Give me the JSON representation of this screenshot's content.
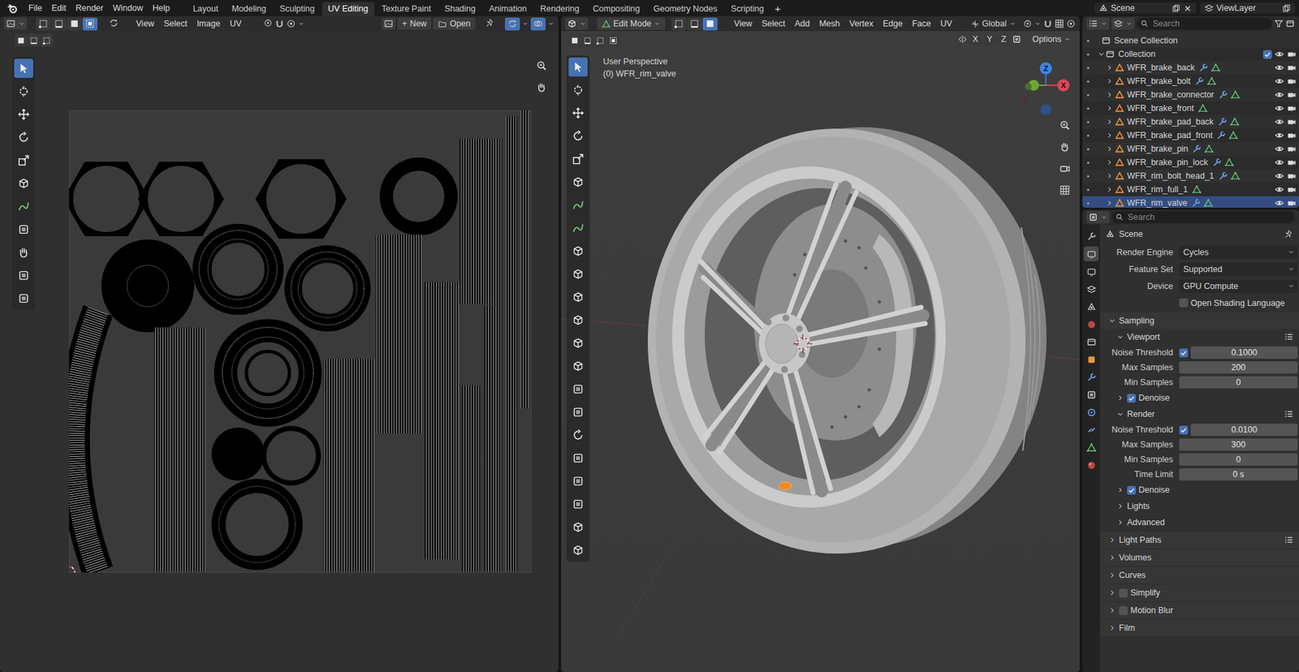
{
  "menubar": {
    "menus": [
      "File",
      "Edit",
      "Render",
      "Window",
      "Help"
    ],
    "workspaces": [
      {
        "label": "Layout",
        "selected": false
      },
      {
        "label": "Modeling",
        "selected": false
      },
      {
        "label": "Sculpting",
        "selected": false
      },
      {
        "label": "UV Editing",
        "selected": true
      },
      {
        "label": "Texture Paint",
        "selected": false
      },
      {
        "label": "Shading",
        "selected": false
      },
      {
        "label": "Animation",
        "selected": false
      },
      {
        "label": "Rendering",
        "selected": false
      },
      {
        "label": "Compositing",
        "selected": false
      },
      {
        "label": "Geometry Nodes",
        "selected": false
      },
      {
        "label": "Scripting",
        "selected": false
      }
    ],
    "add_workspace": "+",
    "scene": "Scene",
    "view_layer": "ViewLayer"
  },
  "uv_editor": {
    "select_modes": [
      {
        "selected": false
      },
      {
        "selected": false
      },
      {
        "selected": false
      },
      {
        "selected": true
      }
    ],
    "menus": [
      "View",
      "Select",
      "Image",
      "UV"
    ],
    "new_button": {
      "icon": "+",
      "label": "New"
    },
    "open_button": "Open",
    "tools": [
      {
        "selected": true
      },
      {
        "selected": false
      },
      {
        "selected": false
      },
      {
        "selected": false
      },
      {
        "selected": false
      },
      {
        "selected": false
      },
      {
        "selected": false
      },
      {
        "selected": false
      },
      {
        "selected": false
      },
      {
        "selected": false
      },
      {
        "selected": false
      }
    ]
  },
  "viewport": {
    "mode": "Edit Mode",
    "select_modes": [
      {
        "selected": false
      },
      {
        "selected": false
      },
      {
        "selected": true
      }
    ],
    "menus": [
      "View",
      "Select",
      "Add",
      "Mesh",
      "Vertex",
      "Edge",
      "Face",
      "UV"
    ],
    "orientation": "Global",
    "mirror_axes": [
      "X",
      "Y",
      "Z"
    ],
    "options": "Options",
    "overlay": {
      "view": "User Perspective",
      "object": "(0) WFR_rim_valve"
    },
    "gizmo_labels": [
      "Z",
      "X"
    ],
    "tools": [
      {
        "selected": true
      },
      {
        "selected": false
      },
      {
        "selected": false
      },
      {
        "selected": false
      },
      {
        "selected": false
      },
      {
        "selected": false
      },
      {
        "selected": false
      },
      {
        "selected": false
      },
      {
        "selected": false
      },
      {
        "selected": false
      },
      {
        "selected": false
      },
      {
        "selected": false
      },
      {
        "selected": false
      },
      {
        "selected": false
      },
      {
        "selected": false
      },
      {
        "selected": false
      },
      {
        "selected": false
      },
      {
        "selected": false
      },
      {
        "selected": false
      },
      {
        "selected": false
      },
      {
        "selected": false
      },
      {
        "selected": false
      }
    ]
  },
  "outliner": {
    "search": "Search",
    "scene_collection": "Scene Collection",
    "collection": {
      "name": "Collection",
      "checked": true
    },
    "objects": [
      {
        "name": "WFR_brake_back",
        "modifiers": true,
        "selected": false
      },
      {
        "name": "WFR_brake_bolt",
        "modifiers": true,
        "selected": false
      },
      {
        "name": "WFR_brake_connector",
        "modifiers": true,
        "selected": false
      },
      {
        "name": "WFR_brake_front",
        "modifiers": false,
        "selected": false
      },
      {
        "name": "WFR_brake_pad_back",
        "modifiers": true,
        "selected": false
      },
      {
        "name": "WFR_brake_pad_front",
        "modifiers": true,
        "selected": false
      },
      {
        "name": "WFR_brake_pin",
        "modifiers": true,
        "selected": false
      },
      {
        "name": "WFR_brake_pin_lock",
        "modifiers": true,
        "selected": false
      },
      {
        "name": "WFR_rim_bolt_head_1",
        "modifiers": true,
        "selected": false
      },
      {
        "name": "WFR_rim_full_1",
        "modifiers": false,
        "selected": false
      },
      {
        "name": "WFR_rim_valve",
        "modifiers": true,
        "selected": true
      }
    ]
  },
  "properties": {
    "search": "Search",
    "tabs": [
      {
        "selected": false
      },
      {
        "selected": true
      },
      {
        "selected": false
      },
      {
        "selected": false
      },
      {
        "selected": false
      },
      {
        "selected": false
      },
      {
        "selected": false
      },
      {
        "selected": false
      },
      {
        "selected": false
      },
      {
        "selected": false
      },
      {
        "selected": false
      },
      {
        "selected": false
      },
      {
        "selected": false
      },
      {
        "selected": false
      }
    ],
    "context": "Scene",
    "rows": [
      {
        "kind": "dropdown",
        "label": "Render Engine",
        "value": "Cycles"
      },
      {
        "kind": "dropdown",
        "label": "Feature Set",
        "value": "Supported"
      },
      {
        "kind": "dropdown",
        "label": "Device",
        "value": "GPU Compute"
      },
      {
        "kind": "check",
        "label": "Open Shading Language",
        "checked": false
      },
      {
        "kind": "panel",
        "label": "Sampling",
        "expanded": true,
        "presets": false
      },
      {
        "kind": "subpanel",
        "label": "Viewport",
        "expanded": true,
        "presets": true
      },
      {
        "kind": "number",
        "label": "Noise Threshold",
        "value": "0.1000",
        "checked": true
      },
      {
        "kind": "number",
        "label": "Max Samples",
        "value": "200"
      },
      {
        "kind": "number",
        "label": "Min Samples",
        "value": "0"
      },
      {
        "kind": "subpanel",
        "label": "Denoise",
        "expanded": false,
        "checked": true,
        "presets": false
      },
      {
        "kind": "subpanel",
        "label": "Render",
        "expanded": true,
        "presets": true
      },
      {
        "kind": "number",
        "label": "Noise Threshold",
        "value": "0.0100",
        "checked": true
      },
      {
        "kind": "number",
        "label": "Max Samples",
        "value": "300"
      },
      {
        "kind": "number",
        "label": "Min Samples",
        "value": "0"
      },
      {
        "kind": "number",
        "label": "Time Limit",
        "value": "0 s"
      },
      {
        "kind": "subpanel",
        "label": "Denoise",
        "expanded": false,
        "checked": true,
        "presets": false
      },
      {
        "kind": "subpanel",
        "label": "Lights",
        "expanded": false,
        "presets": false
      },
      {
        "kind": "subpanel",
        "label": "Advanced",
        "expanded": false,
        "presets": false
      },
      {
        "kind": "panel",
        "label": "Light Paths",
        "expanded": false,
        "presets": true
      },
      {
        "kind": "panel",
        "label": "Volumes",
        "expanded": false,
        "presets": false
      },
      {
        "kind": "panel",
        "label": "Curves",
        "expanded": false,
        "presets": false
      },
      {
        "kind": "panel",
        "label": "Simplify",
        "expanded": false,
        "checked": false,
        "presets": false
      },
      {
        "kind": "panel",
        "label": "Motion Blur",
        "expanded": false,
        "checked": false,
        "presets": false
      },
      {
        "kind": "panel",
        "label": "Film",
        "expanded": false,
        "presets": false
      }
    ]
  }
}
